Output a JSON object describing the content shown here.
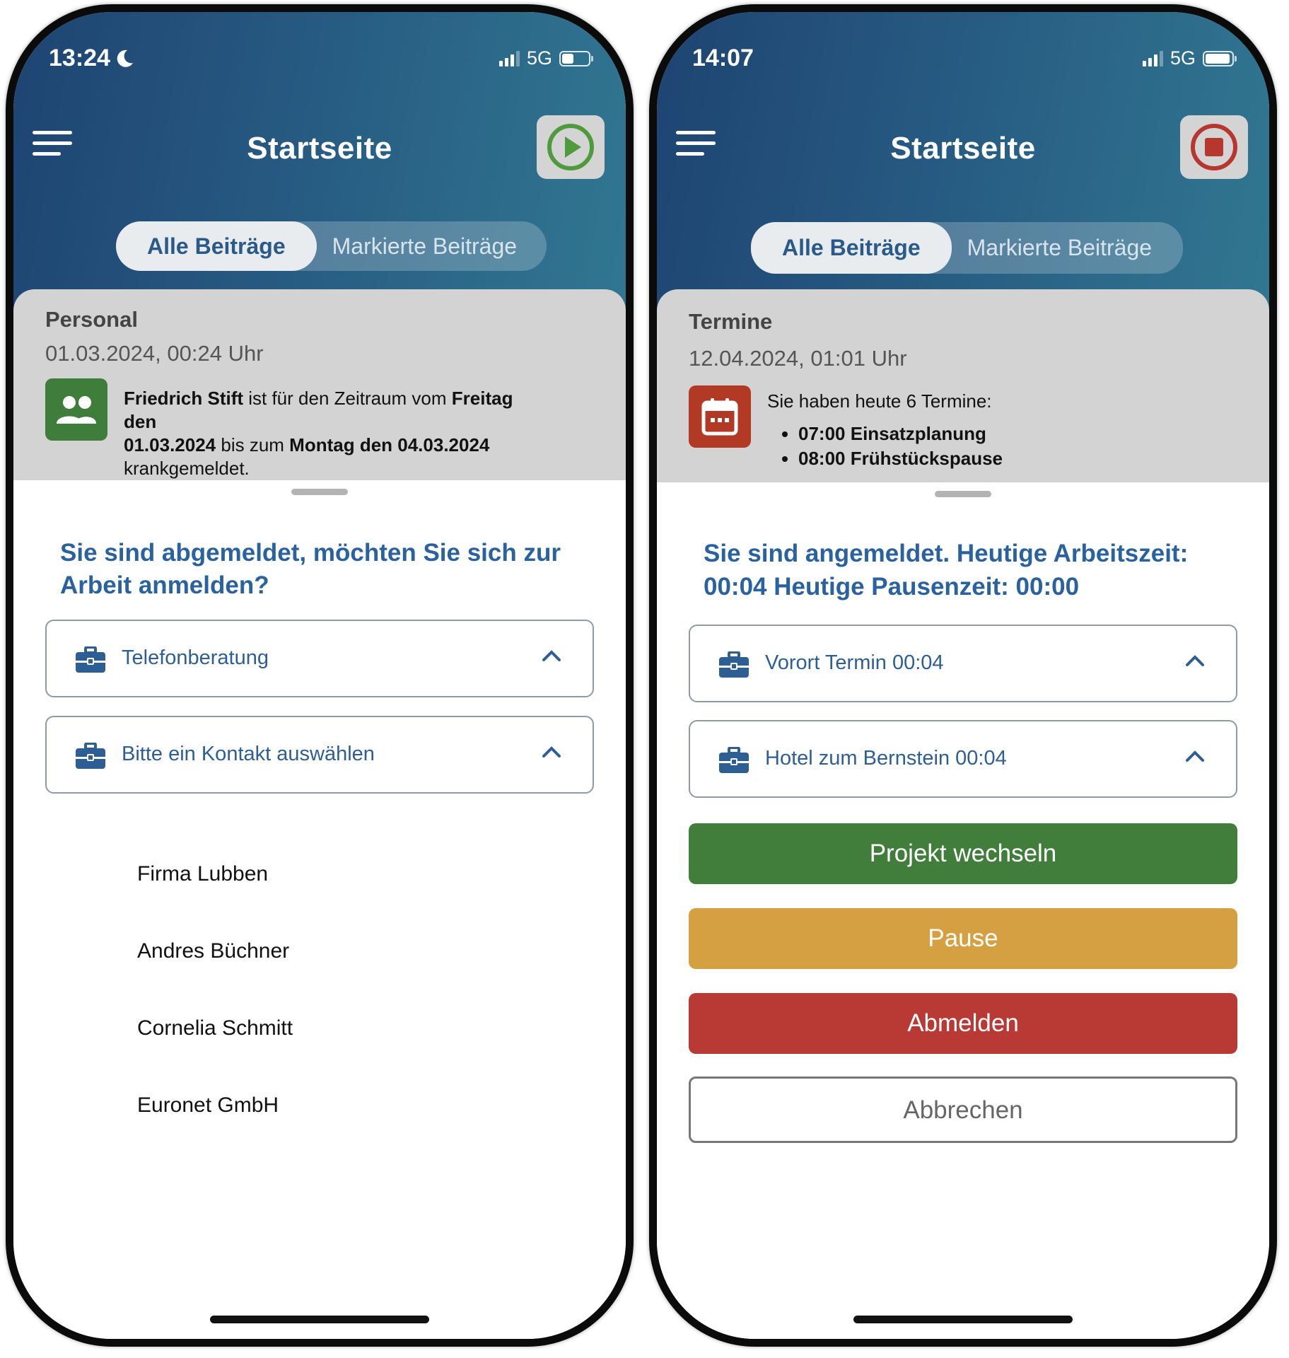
{
  "left": {
    "status": {
      "time": "13:24",
      "network": "5G",
      "battery_level": 0.4
    },
    "header": {
      "title": "Startseite",
      "action": "play"
    },
    "tabs": [
      {
        "label": "Alle Beiträge",
        "active": true
      },
      {
        "label": "Markierte Beiträge",
        "active": false
      }
    ],
    "card": {
      "category": "Personal",
      "date": "01.03.2024, 00:24 Uhr",
      "icon": "people-icon",
      "t1": "Friedrich Stift",
      "t2": " ist für den Zeitraum vom ",
      "t3": "Freitag den",
      "t4": "01.03.2024",
      "t5": " bis zum ",
      "t6": "Montag den 04.03.2024",
      "t7": "krankgemeldet."
    },
    "sheet": {
      "headline": "Sie sind abgemeldet, möchten Sie sich zur Arbeit anmelden?",
      "dropdowns": [
        {
          "label": "Telefonberatung"
        },
        {
          "label": "Bitte ein Kontakt auswählen"
        }
      ],
      "contacts": [
        "Firma Lubben",
        "Andres Büchner",
        "Cornelia Schmitt",
        "Euronet GmbH"
      ]
    }
  },
  "right": {
    "status": {
      "time": "14:07",
      "network": "5G",
      "battery_level": 0.85
    },
    "header": {
      "title": "Startseite",
      "action": "stop"
    },
    "tabs": [
      {
        "label": "Alle Beiträge",
        "active": true
      },
      {
        "label": "Markierte Beiträge",
        "active": false
      }
    ],
    "card": {
      "category": "Termine",
      "date": "12.04.2024, 01:01 Uhr",
      "icon": "calendar-icon",
      "intro": "Sie haben heute 6 Termine:",
      "items": [
        "07:00 Einsatzplanung",
        "08:00 Frühstückspause"
      ]
    },
    "sheet": {
      "headline": "Sie sind angemeldet. Heutige Arbeitszeit: 00:04 Heutige Pausenzeit: 00:00",
      "dropdowns": [
        {
          "label": "Vorort Termin 00:04"
        },
        {
          "label": "Hotel zum Bernstein 00:04"
        }
      ],
      "buttons": {
        "switch": "Projekt wechseln",
        "pause": "Pause",
        "logout": "Abmelden",
        "cancel": "Abbrechen"
      }
    }
  },
  "colors": {
    "header_start": "#1e4472",
    "header_end": "#327a93",
    "accent_text": "#2a62a0",
    "play_green": "#4e9a3c",
    "stop_red": "#b7372f",
    "people_icon_bg": "#3f7d3a",
    "calendar_icon_bg": "#b23a24",
    "btn_switch": "#427e3b",
    "btn_pause": "#d4a042",
    "btn_logout": "#b93a34"
  }
}
